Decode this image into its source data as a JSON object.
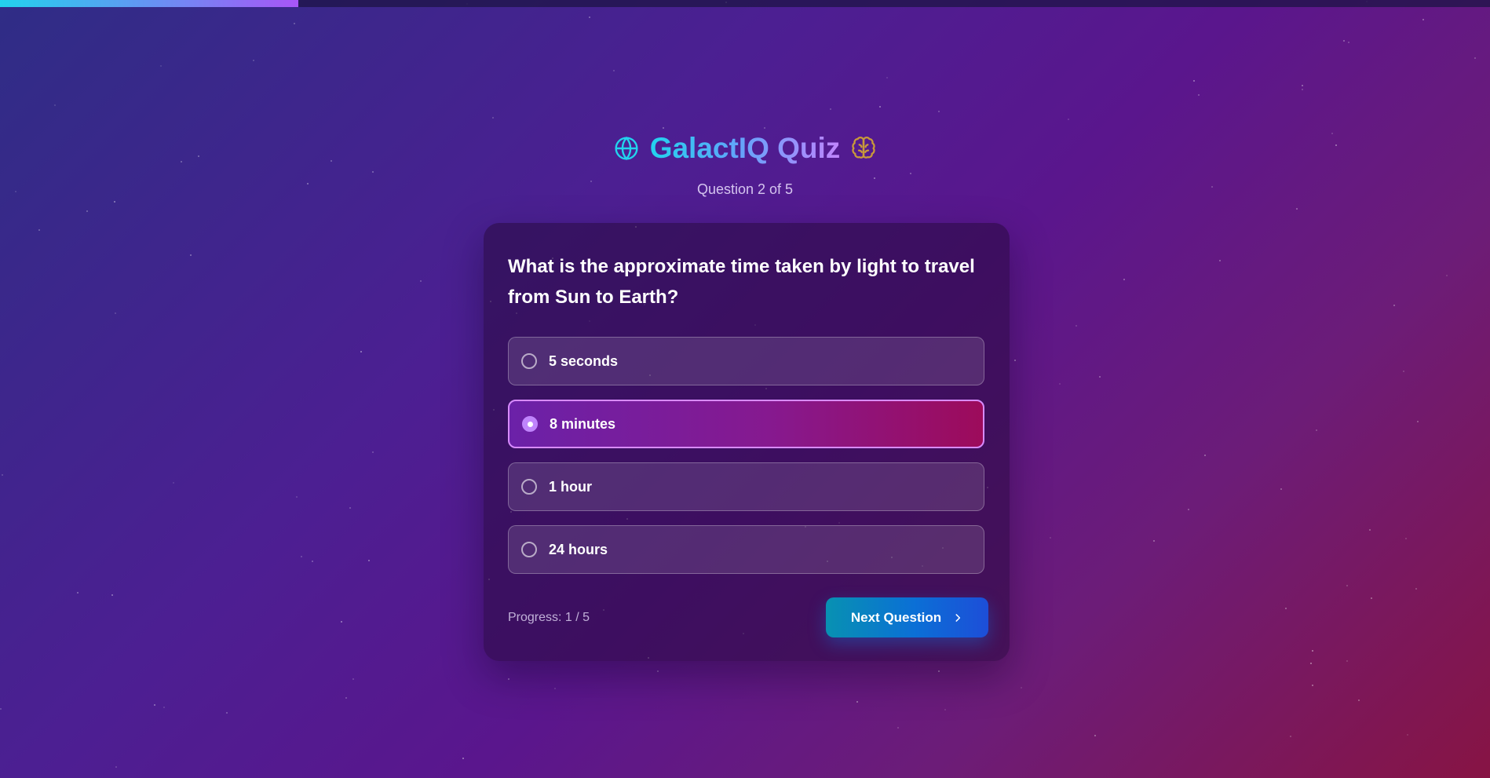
{
  "app": {
    "title": "GalactIQ Quiz",
    "icons": [
      "globe-icon",
      "brain-icon"
    ],
    "accent_colors": {
      "title_gradient_start": "#22d3ee",
      "title_gradient_end": "#c084fc",
      "brain_icon": "#c99a3a",
      "selected_option": "#86198f",
      "next_button": "#0b6fd6"
    }
  },
  "quiz": {
    "question_counter": "Question 2 of 5",
    "question": "What is the approximate time taken by light to travel from Sun to Earth?",
    "options": [
      {
        "label": "5 seconds",
        "selected": false
      },
      {
        "label": "8 minutes",
        "selected": true
      },
      {
        "label": "1 hour",
        "selected": false
      },
      {
        "label": "24 hours",
        "selected": false
      }
    ],
    "progress_text": "Progress: 1 / 5",
    "top_progress_fraction": 0.2,
    "next_button_label": "Next Question"
  }
}
